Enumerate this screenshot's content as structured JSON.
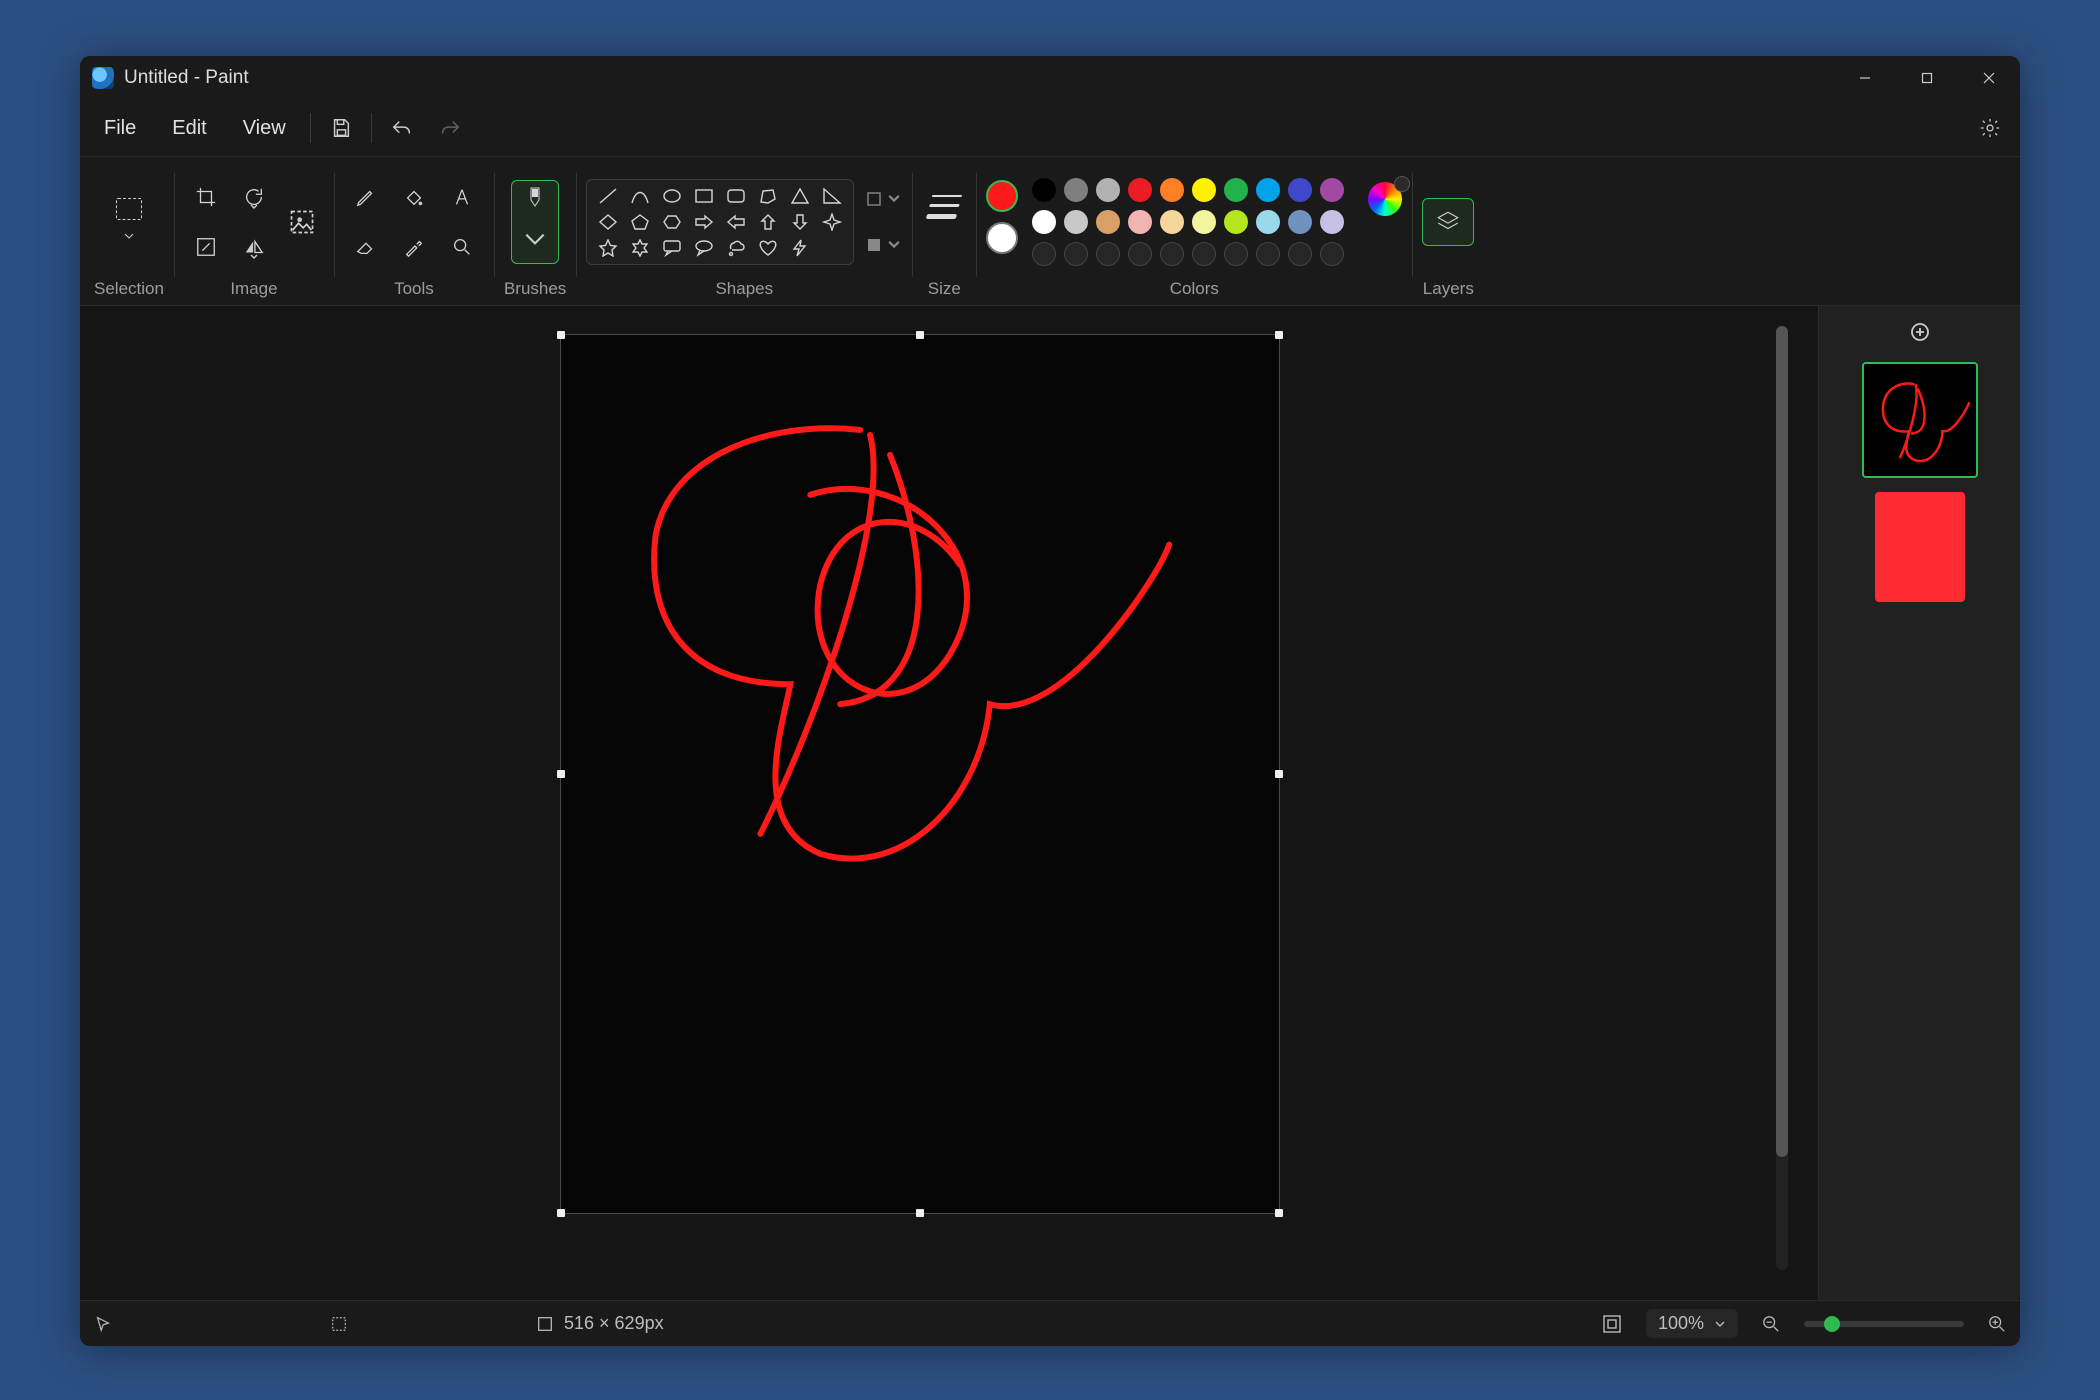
{
  "title": "Untitled - Paint",
  "menu": {
    "file": "File",
    "edit": "Edit",
    "view": "View"
  },
  "ribbon": {
    "selection": "Selection",
    "image": "Image",
    "tools": "Tools",
    "brushes": "Brushes",
    "shapes": "Shapes",
    "size": "Size",
    "colors": "Colors",
    "layers": "Layers"
  },
  "colors": {
    "primary": "#ff1a1a",
    "secondary": "#ffffff",
    "palette_row1": [
      "#000000",
      "#7f7f7f",
      "#b2b2b2",
      "#ed1c24",
      "#ff7f27",
      "#fff200",
      "#22b14c",
      "#00a2e8",
      "#3f48cc",
      "#a349a4"
    ],
    "palette_row2": [
      "#ffffff",
      "#c8c8c8",
      "#d9a066",
      "#f2b3b3",
      "#f5d79c",
      "#f3f59e",
      "#b5e61d",
      "#99d9ea",
      "#7092be",
      "#c8bfe7"
    ]
  },
  "status": {
    "dimensions": "516 × 629px",
    "zoom": "100%"
  }
}
